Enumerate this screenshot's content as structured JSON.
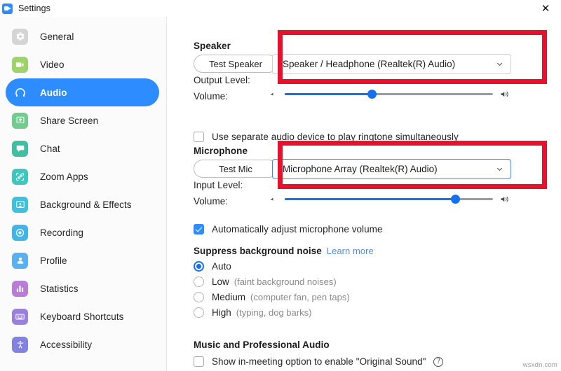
{
  "window": {
    "title": "Settings",
    "logo_icon": "zoom-logo-icon",
    "close_icon": "close-icon"
  },
  "sidebar": {
    "items": [
      {
        "label": "General",
        "icon": "gear-icon",
        "color": "#d4d4d4",
        "active": false
      },
      {
        "label": "Video",
        "icon": "video-camera-icon",
        "color": "#9ed36a",
        "active": false
      },
      {
        "label": "Audio",
        "icon": "headphones-icon",
        "color": "#2D8CFF",
        "active": true
      },
      {
        "label": "Share Screen",
        "icon": "share-screen-icon",
        "color": "#73cb8e",
        "active": false
      },
      {
        "label": "Chat",
        "icon": "chat-bubble-icon",
        "color": "#3fbfa0",
        "active": false
      },
      {
        "label": "Zoom Apps",
        "icon": "zoom-apps-icon",
        "color": "#3fc6bd",
        "active": false
      },
      {
        "label": "Background & Effects",
        "icon": "background-effects-icon",
        "color": "#3fc0dd",
        "active": false
      },
      {
        "label": "Recording",
        "icon": "recording-icon",
        "color": "#41b6e6",
        "active": false
      },
      {
        "label": "Profile",
        "icon": "profile-icon",
        "color": "#5bb0ef",
        "active": false
      },
      {
        "label": "Statistics",
        "icon": "statistics-icon",
        "color": "#bb7cd9",
        "active": false
      },
      {
        "label": "Keyboard Shortcuts",
        "icon": "keyboard-icon",
        "color": "#9a7ee0",
        "active": false
      },
      {
        "label": "Accessibility",
        "icon": "accessibility-icon",
        "color": "#8282e0",
        "active": false
      }
    ]
  },
  "speaker": {
    "heading": "Speaker",
    "test_button": "Test Speaker",
    "device_selected": "Speaker / Headphone (Realtek(R) Audio)",
    "output_level_label": "Output Level:",
    "volume_label": "Volume:",
    "volume_percent": 42,
    "separate_device_checkbox": {
      "label": "Use separate audio device to play ringtone simultaneously",
      "checked": false
    }
  },
  "microphone": {
    "heading": "Microphone",
    "test_button": "Test Mic",
    "device_selected": "Microphone Array (Realtek(R) Audio)",
    "input_level_label": "Input Level:",
    "volume_label": "Volume:",
    "volume_percent": 82,
    "auto_adjust_checkbox": {
      "label": "Automatically adjust microphone volume",
      "checked": true
    }
  },
  "suppress_noise": {
    "heading": "Suppress background noise",
    "learn_more": "Learn more",
    "options": [
      {
        "label": "Auto",
        "hint": "",
        "selected": true
      },
      {
        "label": "Low",
        "hint": "(faint background noises)",
        "selected": false
      },
      {
        "label": "Medium",
        "hint": "(computer fan, pen taps)",
        "selected": false
      },
      {
        "label": "High",
        "hint": "(typing, dog barks)",
        "selected": false
      }
    ]
  },
  "music_audio": {
    "heading": "Music and Professional Audio",
    "original_sound_checkbox": {
      "label": "Show in-meeting option to enable \"Original Sound\"",
      "checked": false
    },
    "help_icon": "question-mark-icon"
  },
  "annotations": {
    "speaker_highlight": "red-highlight-box",
    "microphone_highlight": "red-highlight-box"
  },
  "watermark": "wsxdn.com",
  "colors": {
    "accent": "#2D8CFF",
    "slider": "#1570EF",
    "highlight": "#E8112D",
    "link": "#4f90d8"
  }
}
